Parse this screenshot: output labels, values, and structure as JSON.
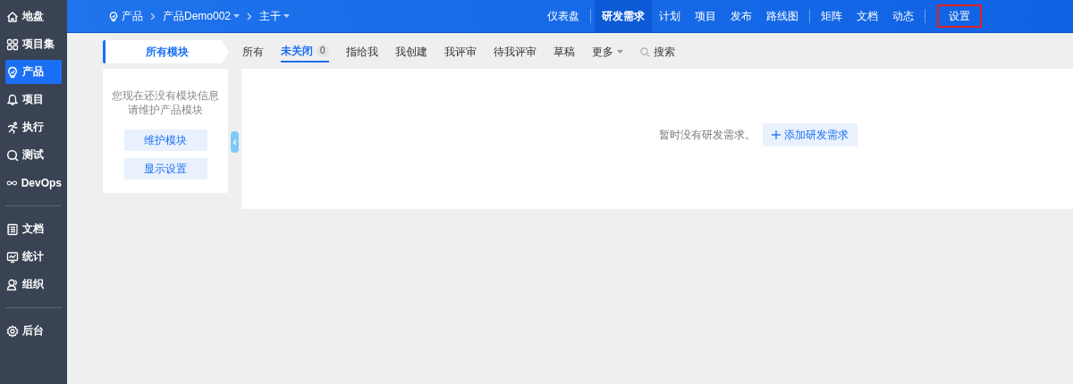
{
  "sidebar": {
    "groups": [
      [
        {
          "label": "地盘",
          "selected": false
        },
        {
          "label": "项目集",
          "selected": false
        },
        {
          "label": "产品",
          "selected": true
        },
        {
          "label": "项目",
          "selected": false
        },
        {
          "label": "执行",
          "selected": false
        },
        {
          "label": "测试",
          "selected": false
        },
        {
          "label": "DevOps",
          "selected": false
        }
      ],
      [
        {
          "label": "文档",
          "selected": false
        },
        {
          "label": "统计",
          "selected": false
        },
        {
          "label": "组织",
          "selected": false
        }
      ],
      [
        {
          "label": "后台",
          "selected": false
        }
      ]
    ]
  },
  "breadcrumb": [
    {
      "label": "产品",
      "dropdown": false
    },
    {
      "label": "产品Demo002",
      "dropdown": true
    },
    {
      "label": "主干",
      "dropdown": true
    }
  ],
  "nav": {
    "groups": [
      [
        {
          "label": "仪表盘",
          "selected": false,
          "highlighted": false
        }
      ],
      [
        {
          "label": "研发需求",
          "selected": true,
          "highlighted": false
        },
        {
          "label": "计划",
          "selected": false,
          "highlighted": false
        },
        {
          "label": "项目",
          "selected": false,
          "highlighted": false
        },
        {
          "label": "发布",
          "selected": false,
          "highlighted": false
        },
        {
          "label": "路线图",
          "selected": false,
          "highlighted": false
        }
      ],
      [
        {
          "label": "矩阵",
          "selected": false,
          "highlighted": false
        },
        {
          "label": "文档",
          "selected": false,
          "highlighted": false
        },
        {
          "label": "动态",
          "selected": false,
          "highlighted": false
        }
      ],
      [
        {
          "label": "设置",
          "selected": false,
          "highlighted": true
        }
      ]
    ]
  },
  "module_tab": {
    "label": "所有模块"
  },
  "filters": [
    {
      "label": "所有",
      "selected": false
    },
    {
      "label": "未关闭",
      "selected": true,
      "count": "0"
    },
    {
      "label": "指给我",
      "selected": false
    },
    {
      "label": "我创建",
      "selected": false
    },
    {
      "label": "我评审",
      "selected": false
    },
    {
      "label": "待我评审",
      "selected": false
    },
    {
      "label": "草稿",
      "selected": false
    }
  ],
  "more_menu": {
    "label": "更多"
  },
  "search": {
    "label": "搜索"
  },
  "module_panel": {
    "message": [
      "您现在还没有模块信息",
      "请维护产品模块"
    ],
    "buttons": [
      "维护模块",
      "显示设置"
    ]
  },
  "empty_state": {
    "message": "暂时没有研发需求。",
    "button": "添加研发需求"
  }
}
